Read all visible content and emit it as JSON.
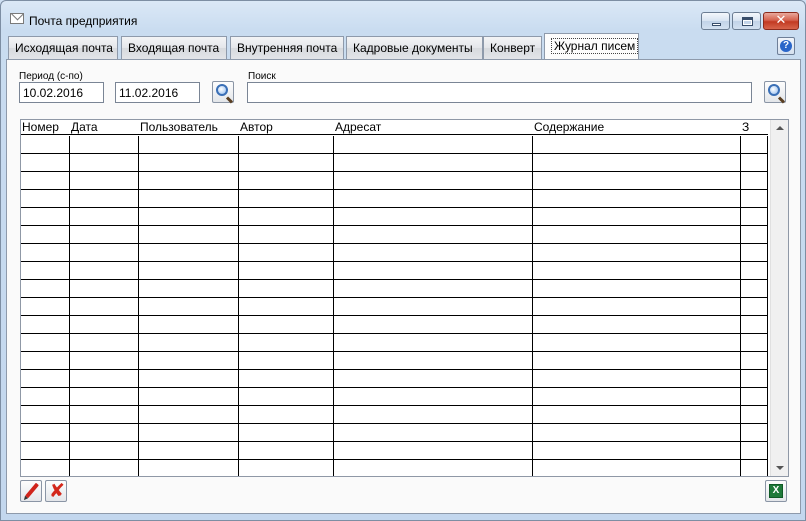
{
  "window": {
    "title": "Почта предприятия"
  },
  "tabs": [
    {
      "label": "Исходящая почта",
      "active": false
    },
    {
      "label": "Входящая почта",
      "active": false
    },
    {
      "label": "Внутренняя почта",
      "active": false
    },
    {
      "label": "Кадровые документы",
      "active": false
    },
    {
      "label": "Конверт",
      "active": false
    },
    {
      "label": "Журнал писем",
      "active": true
    }
  ],
  "filters": {
    "period_label": "Период (с-по)",
    "date_from": "10.02.2016",
    "date_to": "11.02.2016",
    "search_label": "Поиск",
    "search_value": ""
  },
  "grid": {
    "columns": [
      "Номер",
      "Дата",
      "Пользователь",
      "Автор",
      "Адресат",
      "Содержание",
      "З"
    ],
    "rows": []
  },
  "icons": {
    "help": "question-icon",
    "search": "magnifier-icon",
    "edit": "pencil-icon",
    "delete": "delete-icon",
    "export": "excel-icon"
  },
  "colors": {
    "accent": "#2a66c9",
    "close_button": "#c23a22",
    "delete_icon": "#d3271a",
    "excel_icon": "#1f7a3a"
  }
}
